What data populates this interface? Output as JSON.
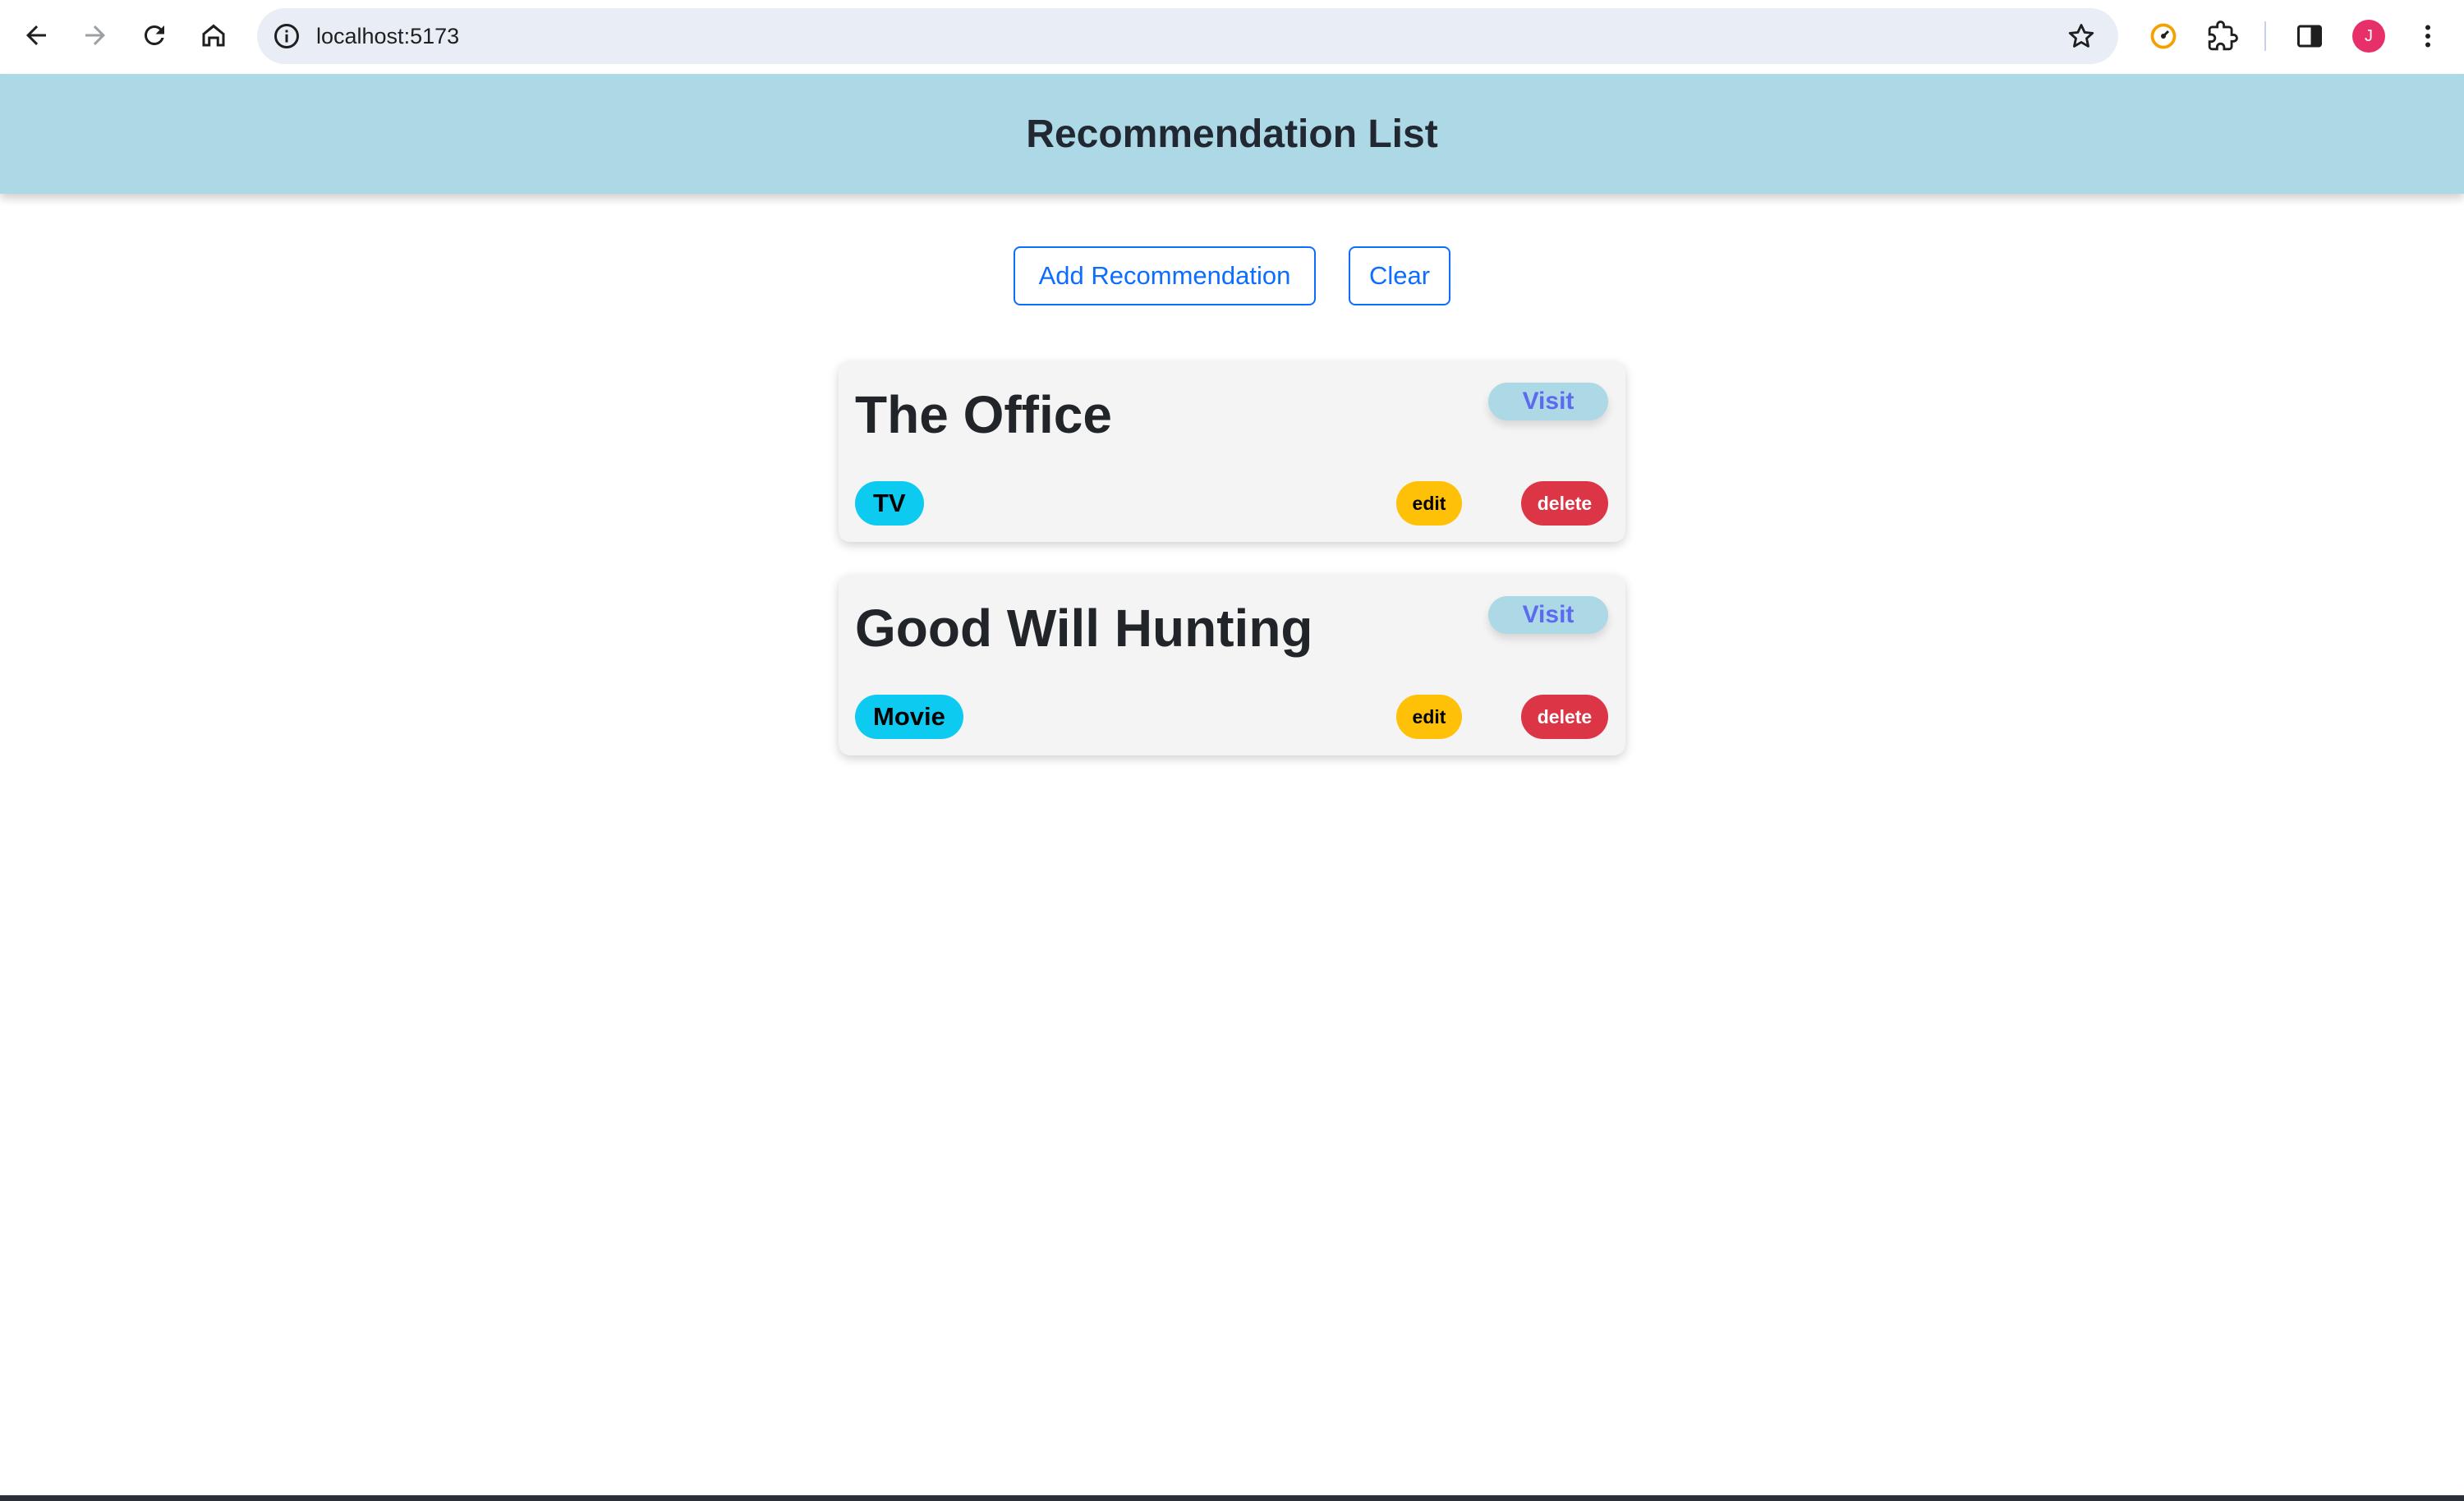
{
  "browser": {
    "url": "localhost:5173",
    "avatar_initial": "J",
    "icons": [
      "back-icon",
      "forward-icon",
      "reload-icon",
      "home-icon",
      "site-info-icon",
      "bookmark-star-icon",
      "performance-extension-icon",
      "extensions-puzzle-icon",
      "side-panel-icon",
      "more-menu-icon"
    ]
  },
  "header": {
    "title": "Recommendation List"
  },
  "actions": {
    "add_label": "Add Recommendation",
    "clear_label": "Clear"
  },
  "recommendations": [
    {
      "title": "The Office",
      "category": "TV",
      "visit_label": "Visit",
      "edit_label": "edit",
      "delete_label": "delete"
    },
    {
      "title": "Good Will Hunting",
      "category": "Movie",
      "visit_label": "Visit",
      "edit_label": "edit",
      "delete_label": "delete"
    }
  ],
  "colors": {
    "header_bg": "#add8e6",
    "primary": "#0d6efd",
    "tag": "#0dcaf0",
    "edit": "#ffc107",
    "delete": "#dc3545",
    "visit_text": "#5b6af0"
  }
}
